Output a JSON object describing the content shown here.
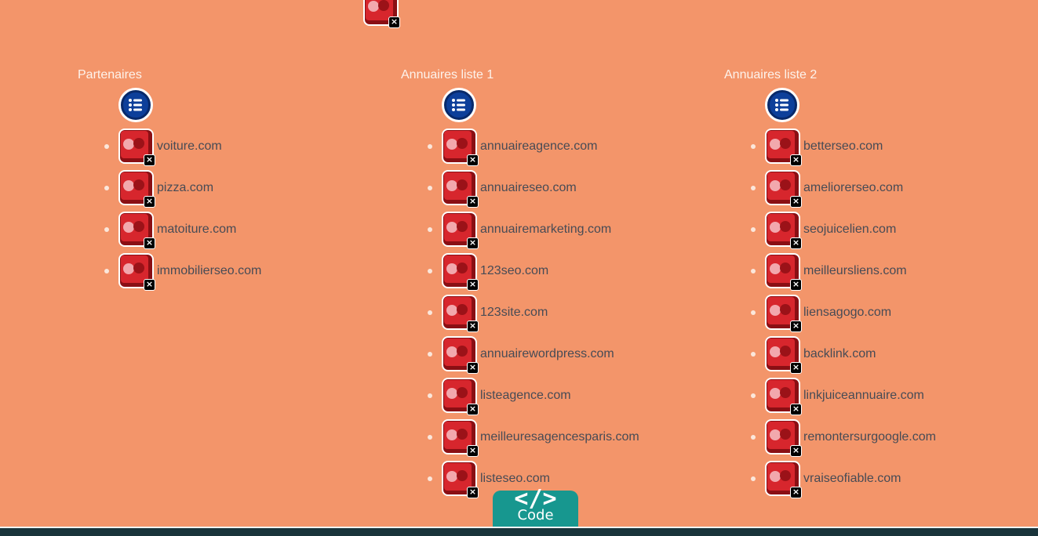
{
  "columns": [
    {
      "title": "Partenaires",
      "links": [
        "voiture.com",
        "pizza.com",
        "matoiture.com",
        "immobilierseo.com"
      ]
    },
    {
      "title": "Annuaires liste 1",
      "links": [
        "annuaireagence.com",
        "annuaireseo.com",
        "annuairemarketing.com",
        "123seo.com",
        "123site.com",
        "annuairewordpress.com",
        "listeagence.com",
        "meilleuresagencesparis.com",
        "listeseo.com"
      ]
    },
    {
      "title": "Annuaires liste 2",
      "links": [
        "betterseo.com",
        "ameliorerseo.com",
        "seojuicelien.com",
        "meilleursliens.com",
        "liensagogo.com",
        "backlink.com",
        "linkjuiceannuaire.com",
        "remontersurgoogle.com",
        "vraiseofiable.com"
      ]
    }
  ],
  "code_button": {
    "glyph": "</>",
    "label": "Code"
  },
  "icons": {
    "app": "red-app-icon",
    "remove": "close-icon",
    "list": "list-icon"
  },
  "colors": {
    "background": "#f3956a",
    "accent": "#17978f",
    "bar": "#19343b"
  }
}
